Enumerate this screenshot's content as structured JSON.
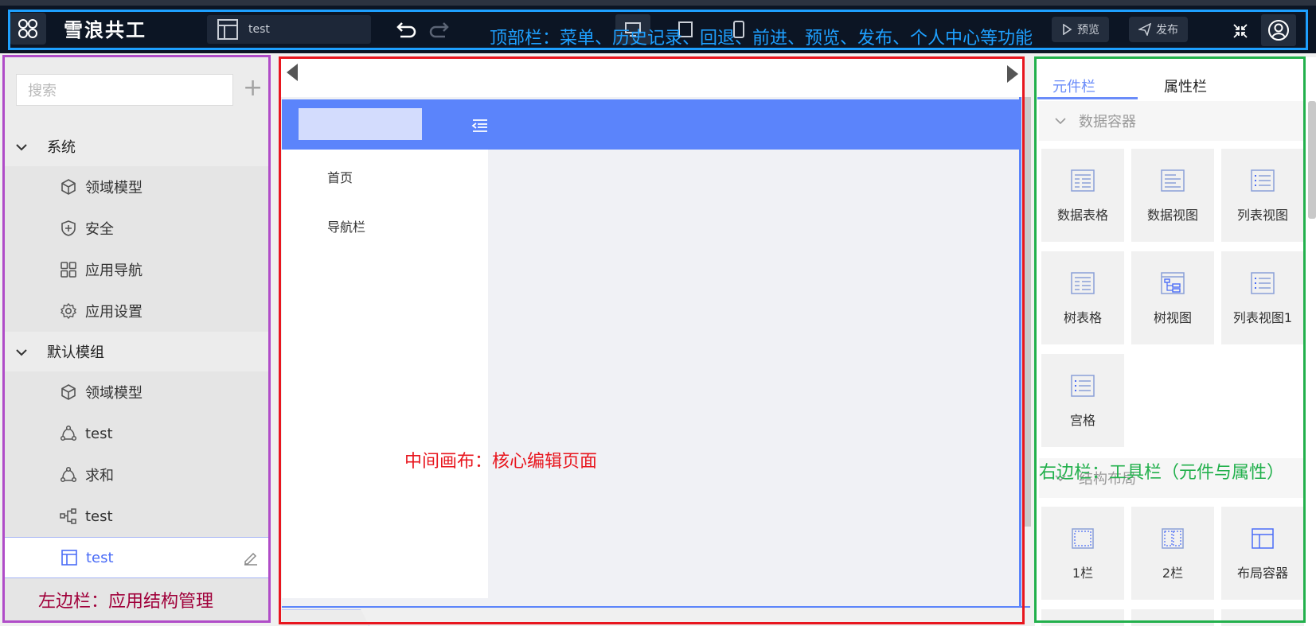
{
  "topbar": {
    "brand": "雪浪共工",
    "page_select": "test",
    "preview_label": "预览",
    "publish_label": "发布"
  },
  "annotations": {
    "top": "顶部栏：菜单、历史记录、回退、前进、预览、发布、个人中心等功能",
    "left": "左边栏：应用结构管理",
    "center": "中间画布：核心编辑页面",
    "right": "右边栏：工具栏（元件与属性）"
  },
  "sidebar": {
    "search_placeholder": "搜索",
    "groups": [
      {
        "title": "系统",
        "items": [
          {
            "label": "领域模型",
            "icon": "cube-icon"
          },
          {
            "label": "安全",
            "icon": "shield-icon"
          },
          {
            "label": "应用导航",
            "icon": "grid-icon"
          },
          {
            "label": "应用设置",
            "icon": "gear-icon"
          }
        ]
      },
      {
        "title": "默认模组",
        "items": [
          {
            "label": "领域模型",
            "icon": "cube-icon"
          },
          {
            "label": "test",
            "icon": "flow-icon"
          },
          {
            "label": "求和",
            "icon": "flow-icon"
          },
          {
            "label": "test",
            "icon": "tree-icon"
          },
          {
            "label": "test",
            "icon": "page-icon",
            "active": true
          }
        ]
      }
    ]
  },
  "canvas": {
    "nav_items": [
      "首页",
      "导航栏"
    ]
  },
  "right_panel": {
    "tabs": [
      "元件栏",
      "属性栏"
    ],
    "active_tab": "元件栏",
    "sections": [
      {
        "title": "数据容器",
        "components": [
          "数据表格",
          "数据视图",
          "列表视图",
          "树表格",
          "树视图",
          "列表视图1",
          "宫格"
        ]
      },
      {
        "title": "结构布局",
        "components": [
          "1栏",
          "2栏",
          "布局容器"
        ]
      }
    ]
  },
  "colors": {
    "topbar_bg": "#0c1524",
    "accent": "#5b84fb",
    "annot_top": "#1ea0ff",
    "annot_left": "#b04cc8",
    "annot_center": "#e8161e",
    "annot_right": "#22b04c"
  }
}
